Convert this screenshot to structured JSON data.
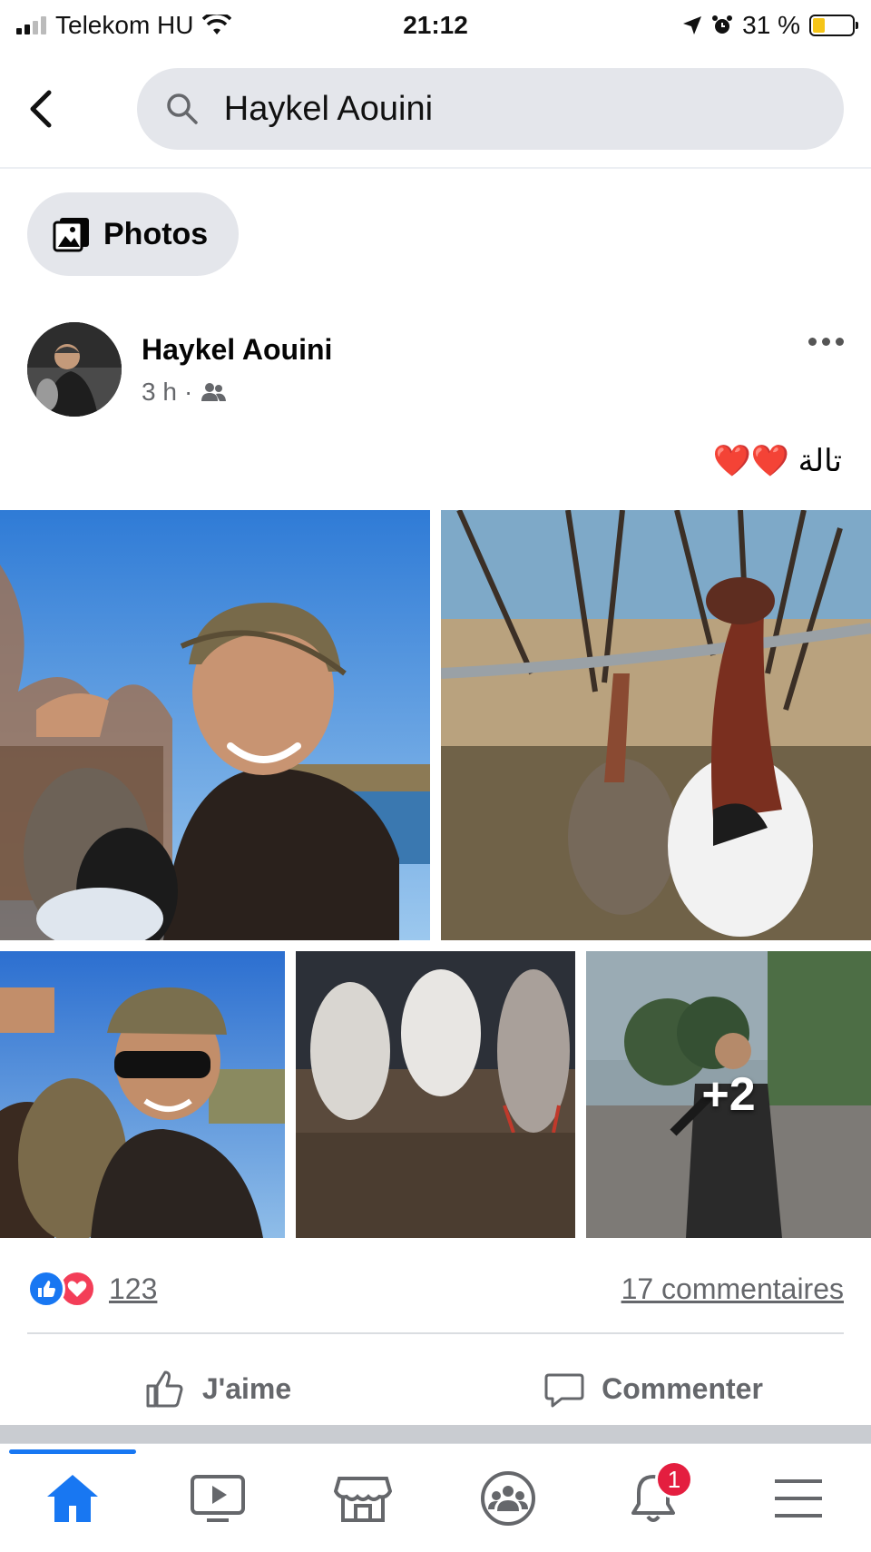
{
  "status_bar": {
    "carrier": "Telekom HU",
    "time": "21:12",
    "battery": "31 %",
    "battery_level": 0.31
  },
  "search": {
    "query": "Haykel Aouini",
    "back_icon": "chevron-left-icon",
    "search_icon": "search-icon"
  },
  "filter_chip": {
    "label": "Photos",
    "icon": "photos-icon"
  },
  "post": {
    "author": "Haykel Aouini",
    "time": "3 h",
    "separator": "·",
    "audience_icon": "friends-icon",
    "text": "تالة ❤️❤️",
    "photos_more": "+2",
    "reaction_count": "123",
    "comments": "17 commentaires",
    "like_label": "J'aime",
    "comment_label": "Commenter"
  },
  "bottom_nav": {
    "tabs": [
      "home-icon",
      "watch-icon",
      "marketplace-icon",
      "groups-icon",
      "notifications-icon",
      "menu-icon"
    ],
    "notification_badge": "1"
  },
  "colors": {
    "accent": "#1877f2",
    "badge": "#e41e3f",
    "secondary_text": "#65676b"
  }
}
